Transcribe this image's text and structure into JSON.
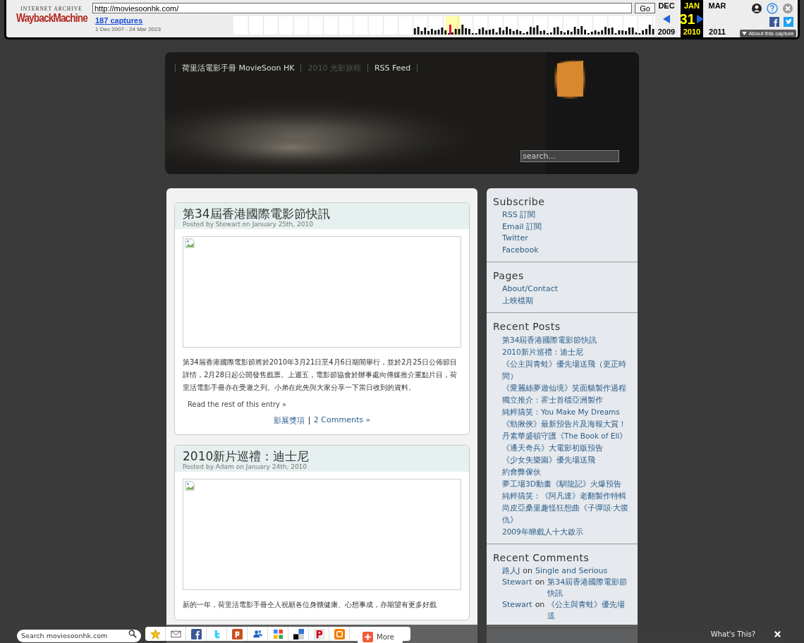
{
  "wayback": {
    "logo_top": "INTERNET ARCHIVE",
    "logo": "WaybackMachine",
    "url": "http://moviesoonhk.com/",
    "go": "Go",
    "captures": "187 captures",
    "range": "1 Dec 2007 - 24 Mar 2023",
    "months": [
      {
        "month": "DEC",
        "year": "2009",
        "selected": false
      },
      {
        "month": "JAN",
        "day": "31",
        "year": "2010",
        "selected": true
      },
      {
        "month": "MAR",
        "year": "2011",
        "selected": false
      }
    ],
    "about": "About this capture"
  },
  "nav": [
    {
      "label": "荷里活電影手冊 MovieSoon HK",
      "disabled": false
    },
    {
      "label": "2010 光影旅程",
      "disabled": true
    },
    {
      "label": "RSS Feed",
      "disabled": false
    }
  ],
  "search": {
    "placeholder": "search..."
  },
  "posts": [
    {
      "title": "第34屆香港國際電影節快訊",
      "byline": "Posted by Stewart on January 25th, 2010",
      "body": "第34屆香港國際電影節將於2010年3月21日至4月6日期間舉行，並於2月25日公佈節目詳情，2月28日起公開發售戲票。上週五，電影節協會於辦事處向傳媒推介重點片目，荷里活電影手冊亦在受邀之列。小弟在此先與大家分享一下當日收到的資料。",
      "more": "Read the rest of this entry »",
      "tag": "影展獎項",
      "comments": "2 Comments »"
    },
    {
      "title": "2010新片巡禮：迪士尼",
      "byline": "Posted by Adam on January 24th, 2010",
      "body": "新的一年，荷里活電影手冊仝人祝願各位身體健康、心想事成，亦期望有更多好戲"
    }
  ],
  "sidebar": [
    {
      "title": "Subscribe",
      "kind": "links",
      "items": [
        "RSS 訂閱",
        "Email 訂閱",
        "Twitter",
        "Facebook"
      ]
    },
    {
      "title": "Pages",
      "kind": "links",
      "items": [
        "About/Contact",
        "上映檔期"
      ]
    },
    {
      "title": "Recent Posts",
      "kind": "posts",
      "items": [
        "第34屆香港國際電影節快訊",
        "2010新片巡禮：迪士尼",
        "《公主與青蛙》優先場送飛（更正時間）",
        "《愛麗絲夢遊仙境》笑面貓製作過程",
        "獨立推介：霍士首檔亞洲製作",
        "純粹搞笑：You Make My Dreams",
        "《勁揪俠》最新預告片及海報大賞！",
        "丹素華盛頓守護《The Book of Eli》",
        "《通天奇兵》大電影初版預告",
        "《少女失樂園》優先場送飛",
        "約會弊傢伙",
        "夢工場3D動畫《馴龍記》火爆預告",
        "純粹搞笑：《阿凡達》老翻製作特輯",
        "尚皮亞桑里趣怪狂想曲《子彈頭·大復仇》",
        "2009年睇戲人十大啟示"
      ]
    },
    {
      "title": "Recent Comments",
      "kind": "comments",
      "items": [
        {
          "author": "路人J",
          "on": "on",
          "post": "Single and Serious"
        },
        {
          "author": "Stewart",
          "on": "on",
          "post": "第34屆香港國際電影節快訊"
        },
        {
          "author": "Stewart",
          "on": "on",
          "post": "《公主與青蛙》優先場送"
        }
      ]
    }
  ],
  "sharebar": {
    "placeholder": "Search moviesoonhk.com",
    "more": "More",
    "whats_this": "What's This?"
  }
}
